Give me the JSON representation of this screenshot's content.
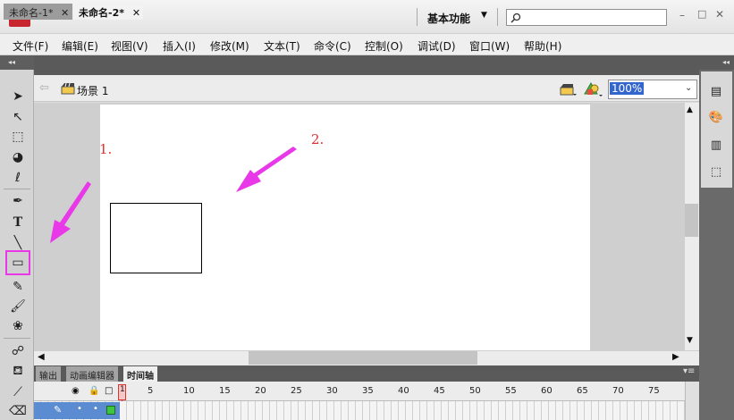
{
  "titlebar": {
    "logo": "Fl",
    "workspace": "基本功能",
    "search_placeholder": "",
    "minimize": "–",
    "maximize": "□",
    "close": "✕"
  },
  "menu": [
    "文件(F)",
    "编辑(E)",
    "视图(V)",
    "插入(I)",
    "修改(M)",
    "文本(T)",
    "命令(C)",
    "控制(O)",
    "调试(D)",
    "窗口(W)",
    "帮助(H)"
  ],
  "tabs": [
    {
      "label": "未命名-1*",
      "close": "✕"
    },
    {
      "label": "未命名-2*",
      "close": "✕"
    }
  ],
  "editbar": {
    "scene": "场景 1",
    "zoom": "100%"
  },
  "annotations": {
    "label1": "1.",
    "label2": "2."
  },
  "panel_tabs": [
    "输出",
    "动画编辑器",
    "时间轴"
  ],
  "timeline": {
    "current_frame": "1",
    "frame_numbers": [
      "5",
      "10",
      "15",
      "20",
      "25",
      "30",
      "35",
      "40",
      "45",
      "50",
      "55",
      "60",
      "65",
      "70",
      "75"
    ]
  },
  "colors": {
    "accent_arrow": "#e838e8",
    "annotation": "#e03030",
    "selection": "#3366cc",
    "logo": "#c8262e"
  }
}
